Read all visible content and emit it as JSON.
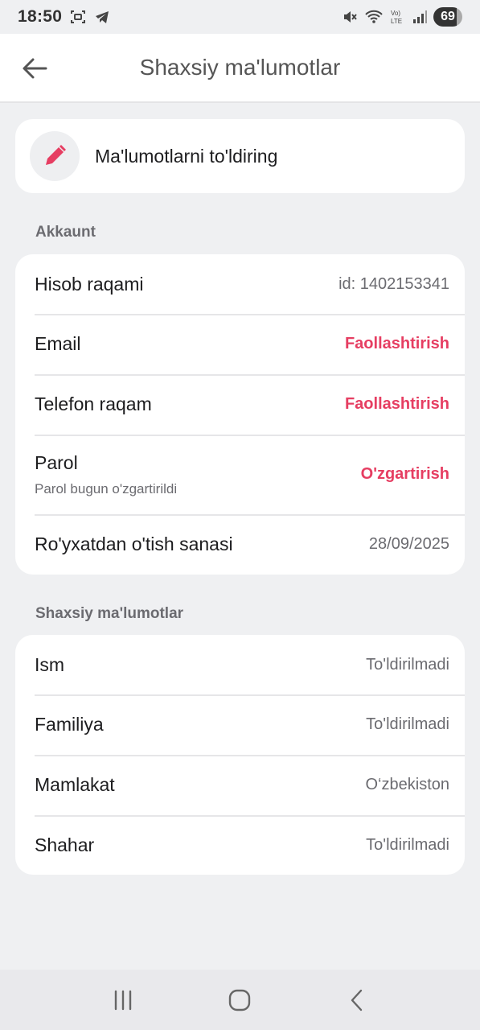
{
  "status_bar": {
    "time": "18:50",
    "battery": "69",
    "icons": [
      "screenshot-icon",
      "telegram-icon",
      "mute-icon",
      "wifi-icon",
      "volte-icon",
      "signal-icon",
      "battery-icon"
    ]
  },
  "header": {
    "title": "Shaxsiy ma'lumotlar",
    "back_icon": "arrow-left-icon"
  },
  "fill_card": {
    "label": "Ma'lumotlarni to'ldiring",
    "icon": "pencil-icon",
    "icon_color": "#e63e62"
  },
  "account": {
    "title": "Akkaunt",
    "rows": [
      {
        "label": "Hisob raqami",
        "value": "id: 1402153341"
      },
      {
        "label": "Email",
        "action": "Faollashtirish"
      },
      {
        "label": "Telefon raqam",
        "action": "Faollashtirish"
      },
      {
        "label": "Parol",
        "sub": "Parol bugun o'zgartirildi",
        "action": "O'zgartirish"
      },
      {
        "label": "Ro'yxatdan o'tish sanasi",
        "value": "28/09/2025"
      }
    ]
  },
  "personal": {
    "title": "Shaxsiy ma'lumotlar",
    "rows": [
      {
        "label": "Ism",
        "value": "To'ldirilmadi"
      },
      {
        "label": "Familiya",
        "value": "To'ldirilmadi"
      },
      {
        "label": "Mamlakat",
        "value": "O‘zbekiston"
      },
      {
        "label": "Shahar",
        "value": "To'ldirilmadi"
      }
    ]
  },
  "colors": {
    "accent": "#e63e62",
    "background": "#eff0f2",
    "card": "#ffffff"
  },
  "nav": {
    "icons": [
      "recent-apps-icon",
      "home-icon",
      "back-nav-icon"
    ]
  }
}
